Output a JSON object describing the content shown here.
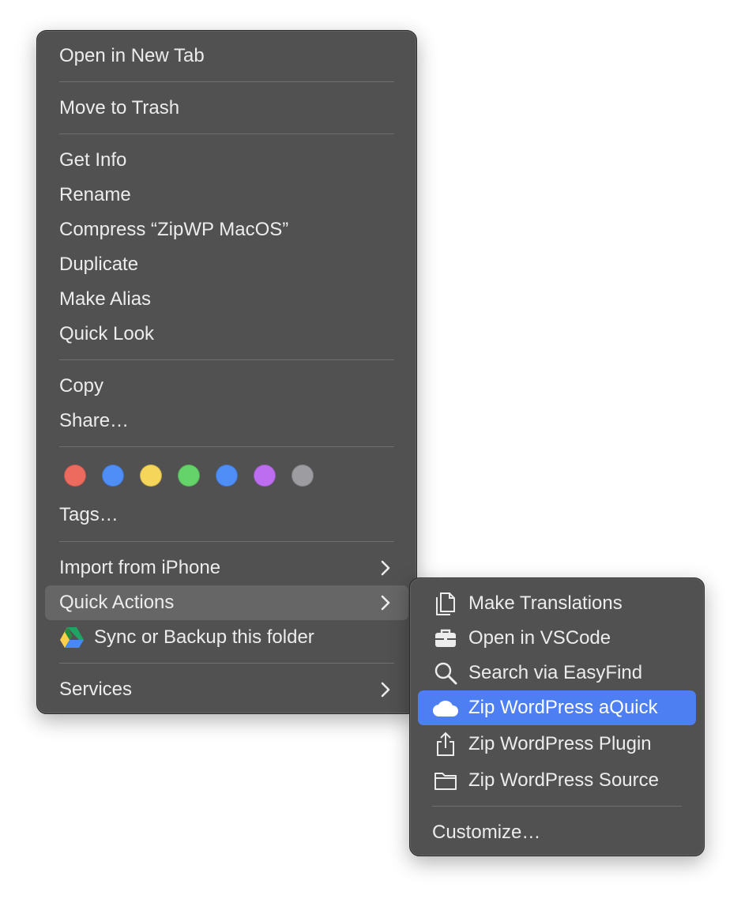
{
  "main_menu": {
    "open_new_tab": "Open in New Tab",
    "move_to_trash": "Move to Trash",
    "get_info": "Get Info",
    "rename": "Rename",
    "compress": "Compress “ZipWP MacOS”",
    "duplicate": "Duplicate",
    "make_alias": "Make Alias",
    "quick_look": "Quick Look",
    "copy": "Copy",
    "share": "Share…",
    "tags_label": "Tags…",
    "import_iphone": "Import from iPhone",
    "quick_actions": "Quick Actions",
    "sync_backup": "Sync or Backup this folder",
    "services": "Services"
  },
  "tag_colors": [
    {
      "name": "red",
      "color": "#ec6a5e"
    },
    {
      "name": "blue",
      "color": "#4f8ef7"
    },
    {
      "name": "yellow",
      "color": "#f5d65a"
    },
    {
      "name": "green",
      "color": "#64d36a"
    },
    {
      "name": "blue-2",
      "color": "#4f8ef7"
    },
    {
      "name": "purple",
      "color": "#bd6ef0"
    },
    {
      "name": "gray",
      "color": "#9d9da1"
    }
  ],
  "quick_actions_menu": {
    "make_translations": "Make Translations",
    "open_vscode": "Open in VSCode",
    "search_easyfind": "Search via EasyFind",
    "zip_aquick": "Zip WordPress aQuick",
    "zip_plugin": "Zip WordPress Plugin",
    "zip_source": "Zip WordPress Source",
    "customize": "Customize…"
  },
  "colors": {
    "menu_bg": "#515151",
    "highlight": "#666666",
    "selected": "#4d7ff2"
  }
}
